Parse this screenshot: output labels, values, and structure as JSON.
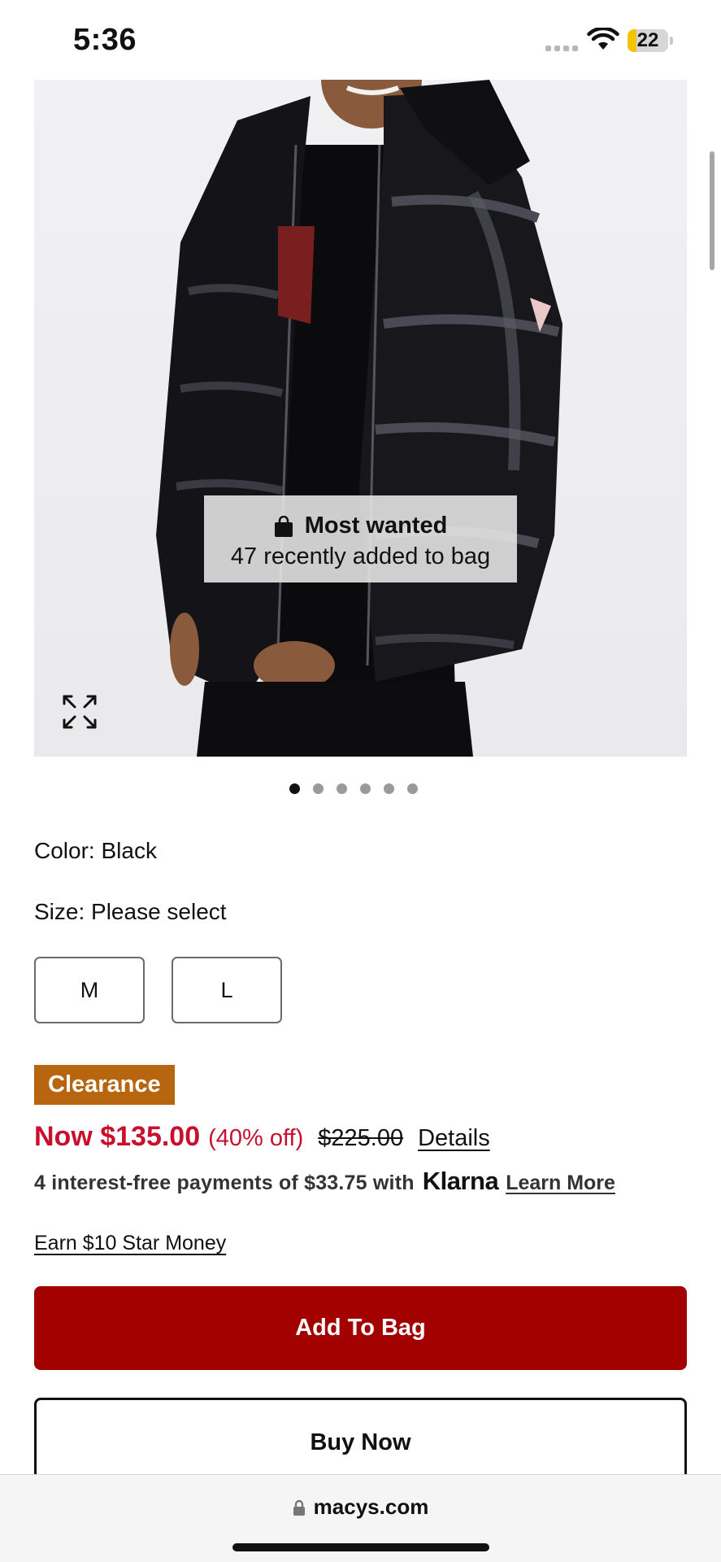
{
  "status_bar": {
    "time": "5:36",
    "battery_level": "22",
    "battery_fraction": 0.22,
    "icons": [
      "signal-dots-icon",
      "wifi-icon",
      "battery-icon"
    ]
  },
  "product_image": {
    "badge_title": "Most wanted",
    "badge_subtitle": "47 recently added to bag",
    "icons": [
      "shopping-bag-icon",
      "expand-icon"
    ],
    "carousel": {
      "total": 6,
      "active_index": 0
    }
  },
  "options": {
    "color_line": "Color: Black",
    "size_line": "Size: Please select",
    "sizes": [
      "M",
      "L"
    ]
  },
  "pricing": {
    "badge": "Clearance",
    "now_price": "Now $135.00",
    "discount": "(40% off)",
    "original_price": "$225.00",
    "details_link": "Details",
    "klarna_text": "4 interest-free payments of $33.75 with",
    "klarna_brand": "Klarna",
    "klarna_learn_more": "Learn More",
    "earn_star_money": "Earn $10 Star Money"
  },
  "actions": {
    "add_to_bag": "Add To Bag",
    "buy_now": "Buy Now"
  },
  "browser": {
    "url": "macys.com"
  },
  "colors": {
    "sale_red": "#c8102e",
    "add_to_bag_bg": "#a30000",
    "clearance_bg": "#b8650f",
    "battery_yellow": "#f5c400"
  }
}
